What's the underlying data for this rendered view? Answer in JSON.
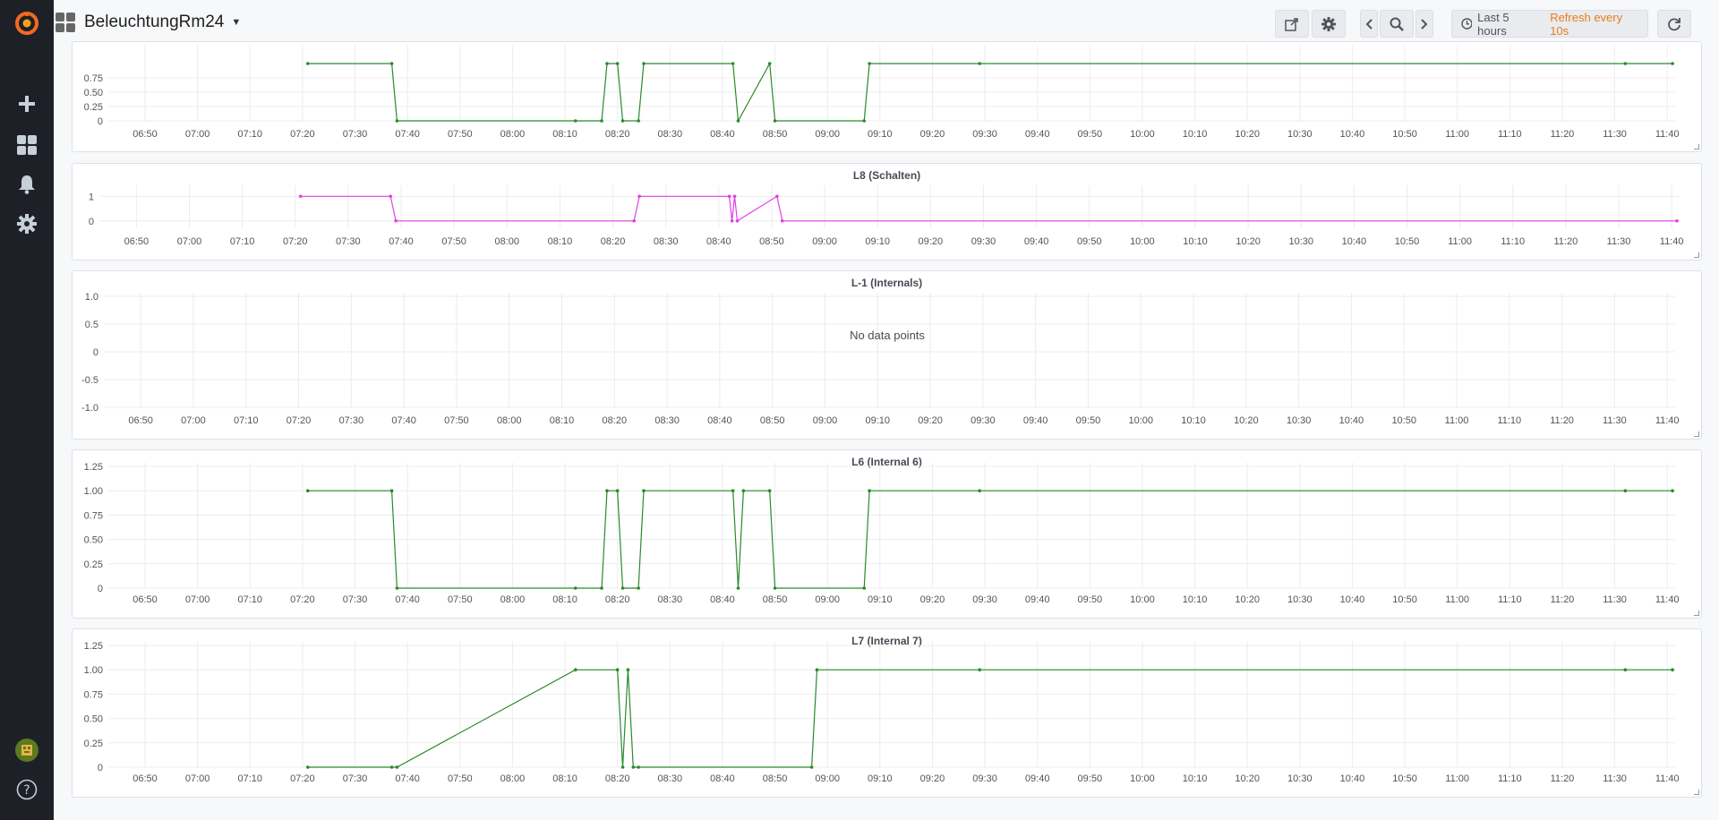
{
  "app": {
    "dashboard_title": "BeleuchtungRm24",
    "time_range_label": "Last 5 hours",
    "refresh_label": "Refresh every 10s"
  },
  "sidebar": {
    "icons": [
      "grafana-logo-icon",
      "plus-icon",
      "dashboards-icon",
      "bell-icon",
      "gear-icon",
      "avatar",
      "help-icon"
    ]
  },
  "toolbar": {
    "icons": [
      "share-icon",
      "settings-icon",
      "chevron-left-icon",
      "zoom-out-icon",
      "chevron-right-icon",
      "clock-icon",
      "refresh-icon"
    ]
  },
  "colors": {
    "green": "#2a8a2a",
    "magenta": "#e33ce6",
    "accent": "#eb7b18"
  },
  "x_ticks": [
    "06:50",
    "07:00",
    "07:10",
    "07:20",
    "07:30",
    "07:40",
    "07:50",
    "08:00",
    "08:10",
    "08:20",
    "08:30",
    "08:40",
    "08:50",
    "09:00",
    "09:10",
    "09:20",
    "09:30",
    "09:40",
    "09:50",
    "10:00",
    "10:10",
    "10:20",
    "10:30",
    "10:40",
    "10:50",
    "11:00",
    "11:10",
    "11:20",
    "11:30",
    "11:40"
  ],
  "chart_data": [
    {
      "type": "line",
      "title": "",
      "ylim": [
        0,
        1.25
      ],
      "yticks": [
        "0.75",
        "0.50",
        "0.25",
        "0"
      ],
      "series": [
        {
          "color": "#2a8a2a",
          "x": [
            "07:21",
            "07:37",
            "07:38",
            "08:12",
            "08:17",
            "08:18",
            "08:20",
            "08:21",
            "08:24",
            "08:25",
            "08:42",
            "08:43",
            "08:49",
            "08:50",
            "09:07",
            "09:08",
            "09:29",
            "11:32",
            "11:41"
          ],
          "values": [
            1,
            1,
            0,
            0,
            0,
            1,
            1,
            0,
            0,
            1,
            1,
            0,
            1,
            0,
            0,
            1,
            1,
            1,
            1
          ]
        }
      ]
    },
    {
      "type": "line",
      "title": "L8 (Schalten)",
      "ylim": [
        -0.3,
        1.3
      ],
      "yticks": [
        "1",
        "0"
      ],
      "series": [
        {
          "color": "#e33ce6",
          "x": [
            "07:21",
            "07:38",
            "07:39",
            "08:24",
            "08:25",
            "08:42",
            "08:42.5",
            "08:43",
            "08:43.5",
            "08:51",
            "08:52",
            "11:41"
          ],
          "values": [
            1,
            1,
            0,
            0,
            1,
            1,
            0,
            1,
            0,
            1,
            0,
            0
          ]
        }
      ]
    },
    {
      "type": "line",
      "title": "L-1 (Internals)",
      "ylim": [
        -1,
        1
      ],
      "yticks": [
        "1.0",
        "0.5",
        "0",
        "-0.5",
        "-1.0"
      ],
      "no_data_text": "No data points",
      "series": []
    },
    {
      "type": "line",
      "title": "L6 (Internal 6)",
      "ylim": [
        0,
        1.25
      ],
      "yticks": [
        "1.25",
        "1.00",
        "0.75",
        "0.50",
        "0.25",
        "0"
      ],
      "series": [
        {
          "color": "#2a8a2a",
          "x": [
            "07:21",
            "07:37",
            "07:38",
            "08:12",
            "08:17",
            "08:18",
            "08:20",
            "08:21",
            "08:24",
            "08:25",
            "08:42",
            "08:43",
            "08:44",
            "08:49",
            "08:50",
            "09:07",
            "09:08",
            "09:29",
            "11:32",
            "11:41"
          ],
          "values": [
            1,
            1,
            0,
            0,
            0,
            1,
            1,
            0,
            0,
            1,
            1,
            0,
            1,
            1,
            0,
            0,
            1,
            1,
            1,
            1
          ]
        }
      ]
    },
    {
      "type": "line",
      "title": "L7 (Internal 7)",
      "ylim": [
        0,
        1.25
      ],
      "yticks": [
        "1.25",
        "1.00",
        "0.75",
        "0.50",
        "0.25",
        "0"
      ],
      "series": [
        {
          "color": "#2a8a2a",
          "x": [
            "07:21",
            "07:37",
            "07:38",
            "08:12",
            "08:20",
            "08:21",
            "08:22",
            "08:23",
            "08:24",
            "08:57",
            "08:58",
            "09:29",
            "11:32",
            "11:41"
          ],
          "values": [
            0,
            0,
            0,
            1,
            1,
            0,
            1,
            0,
            0,
            0,
            1,
            1,
            1,
            1
          ]
        }
      ]
    }
  ]
}
